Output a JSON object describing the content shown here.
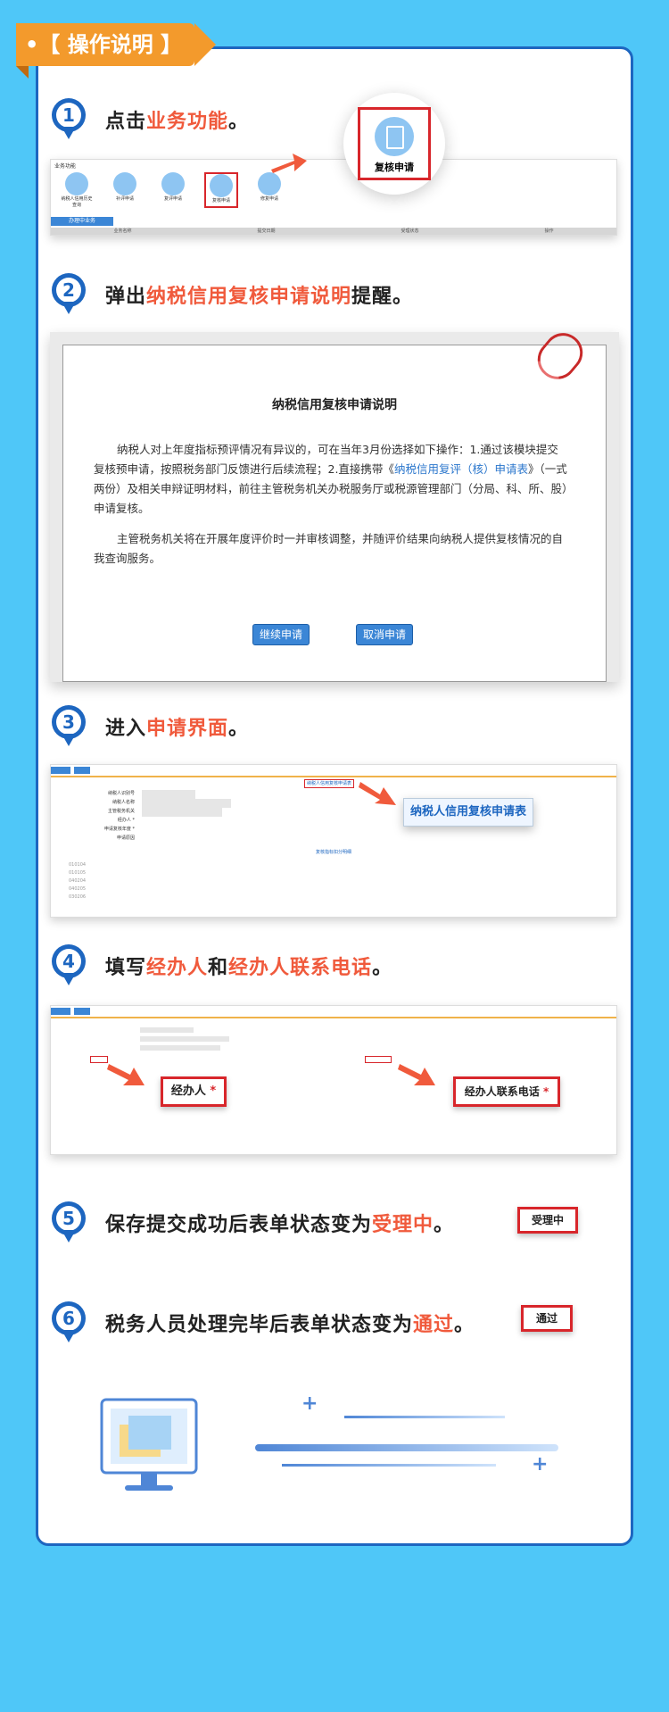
{
  "header": {
    "title": "•【 操作说明 】"
  },
  "steps": [
    {
      "num": "1",
      "pre": "点击",
      "hl": "业务功能",
      "post": "。"
    },
    {
      "num": "2",
      "pre": "弹出",
      "hl": "纳税信用复核申请说明",
      "post": "提醒。"
    },
    {
      "num": "3",
      "pre": "进入",
      "hl": "申请界面",
      "post": "。"
    },
    {
      "num": "4",
      "pre": "填写",
      "hl": "经办人",
      "mid": "和",
      "hl2": "经办人联系电话",
      "post": "。"
    },
    {
      "num": "5",
      "pre": "保存提交成功后表单状态变为",
      "hl": "受理中",
      "post": "。"
    },
    {
      "num": "6",
      "pre": "税务人员处理完毕后表单状态变为",
      "hl": "通过",
      "post": "。"
    }
  ],
  "shot1": {
    "heading": "业务功能",
    "icons": [
      "纳税人信用历史查询",
      "补评申请",
      "复评申请",
      "复核申请",
      "修复申请"
    ],
    "tab": "办理中业务",
    "cols": [
      "业务名称",
      "提交日期",
      "受理状态",
      "操作"
    ],
    "magnify_label": "复核申请"
  },
  "dialog": {
    "title": "纳税信用复核申请说明",
    "para1_a": "纳税人对上年度指标预评情况有异议的，可在当年3月份选择如下操作：1.通过该模块提交复核预申请，按照税务部门反馈进行后续流程；2.直接携带《",
    "para1_link": "纳税信用复评（核）申请表",
    "para1_b": "》（一式两份）及相关申辩证明材料，前往主管税务机关办税服务厅或税源管理部门（分局、科、所、股）申请复核。",
    "para2": "主管税务机关将在开展年度评价时一并审核调整，并随评价结果向纳税人提供复核情况的自我查询服务。",
    "btn_continue": "继续申请",
    "btn_cancel": "取消申请"
  },
  "shot3": {
    "form_title": "纳税人信用复核申请表",
    "popup": "纳税人信用复核申请表",
    "fields": [
      "纳税人识别号",
      "纳税人名称",
      "主管税务机关",
      "经办人 *",
      "申请复核年度 *",
      "申请原因"
    ],
    "section": "复核指标扣分明细",
    "codes": [
      "010104",
      "010105",
      "040204",
      "040205",
      "030206"
    ]
  },
  "shot4": {
    "label_handler": "经办人",
    "label_phone": "经办人联系电话",
    "star": "*"
  },
  "status": {
    "accepted": "受理中",
    "passed": "通过"
  }
}
